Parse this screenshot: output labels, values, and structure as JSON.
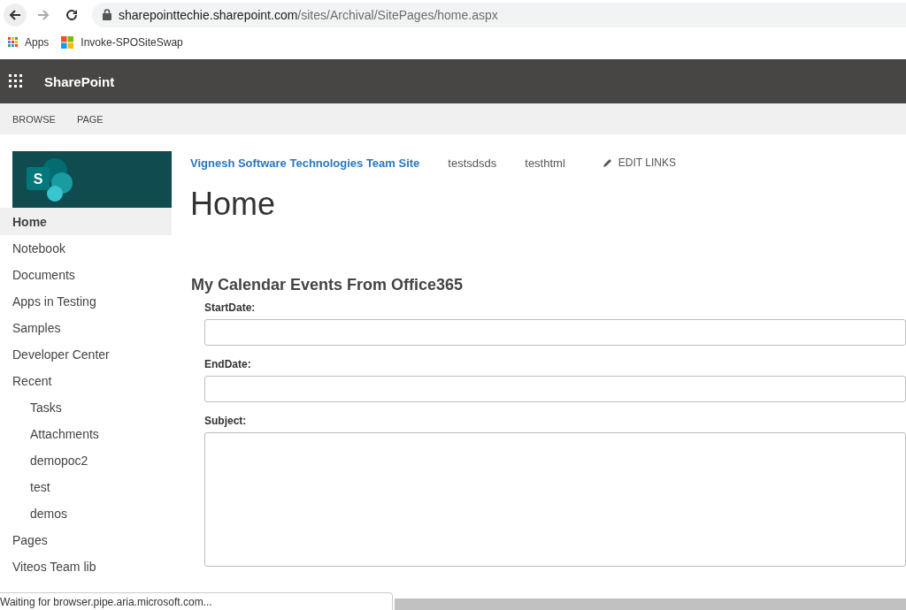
{
  "browser": {
    "url_host": "sharepointtechie.sharepoint.com",
    "url_path": "/sites/Archival/SitePages/home.aspx",
    "bookmarks": [
      {
        "label": "Apps",
        "kind": "apps"
      },
      {
        "label": "Invoke-SPOSiteSwap",
        "kind": "windows"
      }
    ]
  },
  "suite_bar": {
    "title": "SharePoint"
  },
  "site_logo": {
    "letter": "S"
  },
  "ribbon": {
    "tabs": [
      "BROWSE",
      "PAGE"
    ]
  },
  "top_nav": {
    "site_title": "Vignesh Software Technologies Team Site",
    "links": [
      "testsdsds",
      "testhtml"
    ],
    "edit_links": "EDIT LINKS"
  },
  "left_nav": [
    {
      "label": "Home",
      "selected": true
    },
    {
      "label": "Notebook",
      "selected": false
    },
    {
      "label": "Documents",
      "selected": false
    },
    {
      "label": "Apps in Testing",
      "selected": false
    },
    {
      "label": "Samples",
      "selected": false
    },
    {
      "label": "Developer Center",
      "selected": false
    },
    {
      "label": "Recent",
      "selected": false,
      "children": [
        {
          "label": "Tasks",
          "selected": false
        },
        {
          "label": "Attachments",
          "selected": false
        },
        {
          "label": "demopoc2",
          "selected": false
        },
        {
          "label": "test",
          "selected": false
        },
        {
          "label": "demos",
          "selected": false
        }
      ]
    },
    {
      "label": "Pages",
      "selected": false
    },
    {
      "label": "Viteos Team lib",
      "selected": false
    }
  ],
  "page_title": "Home",
  "form": {
    "heading": "My Calendar Events From Office365",
    "fields": [
      {
        "label": "StartDate:",
        "kind": "input"
      },
      {
        "label": "EndDate:",
        "kind": "input"
      },
      {
        "label": "Subject:",
        "kind": "textarea"
      }
    ]
  },
  "status_text": "Waiting for browser.pipe.aria.microsoft.com..."
}
